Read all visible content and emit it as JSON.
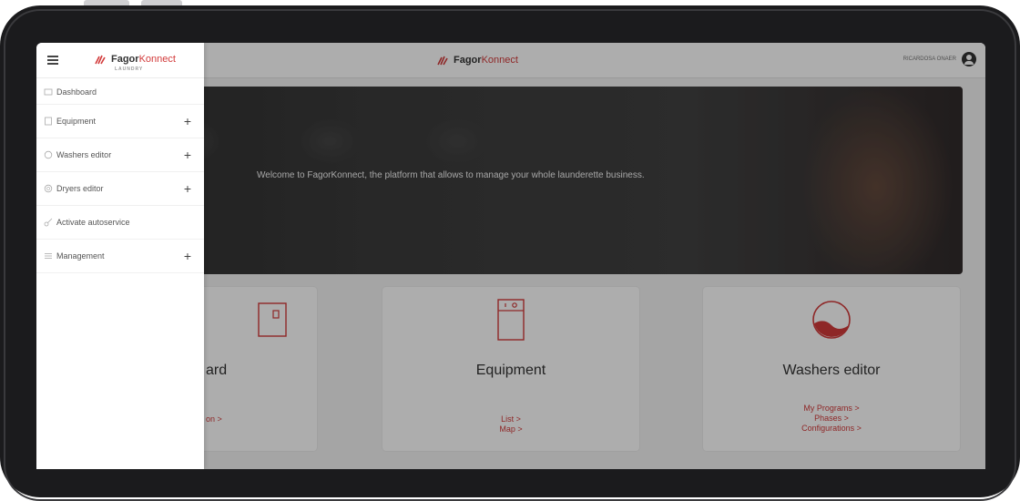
{
  "brand": {
    "name_part1": "Fagor",
    "name_part2": "Konnect",
    "tagline": "LAUNDRY"
  },
  "user": {
    "name": "RICARDOSA ONAER"
  },
  "hero": {
    "text": "Welcome to FagorKonnect, the platform that allows to manage your whole launderette business."
  },
  "sidebar": {
    "items": [
      {
        "label": "Dashboard",
        "icon": "dashboard-icon",
        "expandable": false
      },
      {
        "label": "Equipment",
        "icon": "equipment-icon",
        "expandable": true
      },
      {
        "label": "Washers editor",
        "icon": "washer-icon",
        "expandable": true
      },
      {
        "label": "Dryers editor",
        "icon": "dryer-icon",
        "expandable": true
      },
      {
        "label": "Activate autoservice",
        "icon": "key-icon",
        "expandable": false
      },
      {
        "label": "Management",
        "icon": "management-icon",
        "expandable": true
      }
    ],
    "plus": "+"
  },
  "cards": {
    "dashboard": {
      "title": "ard",
      "link1": "on >"
    },
    "equipment": {
      "title": "Equipment",
      "link1": "List >",
      "link2": "Map >"
    },
    "washers": {
      "title": "Washers editor",
      "link1": "My Programs >",
      "link2": "Phases >",
      "link3": "Configurations >"
    }
  },
  "colors": {
    "accent": "#d23a3a",
    "device": "#1b1b1d"
  }
}
